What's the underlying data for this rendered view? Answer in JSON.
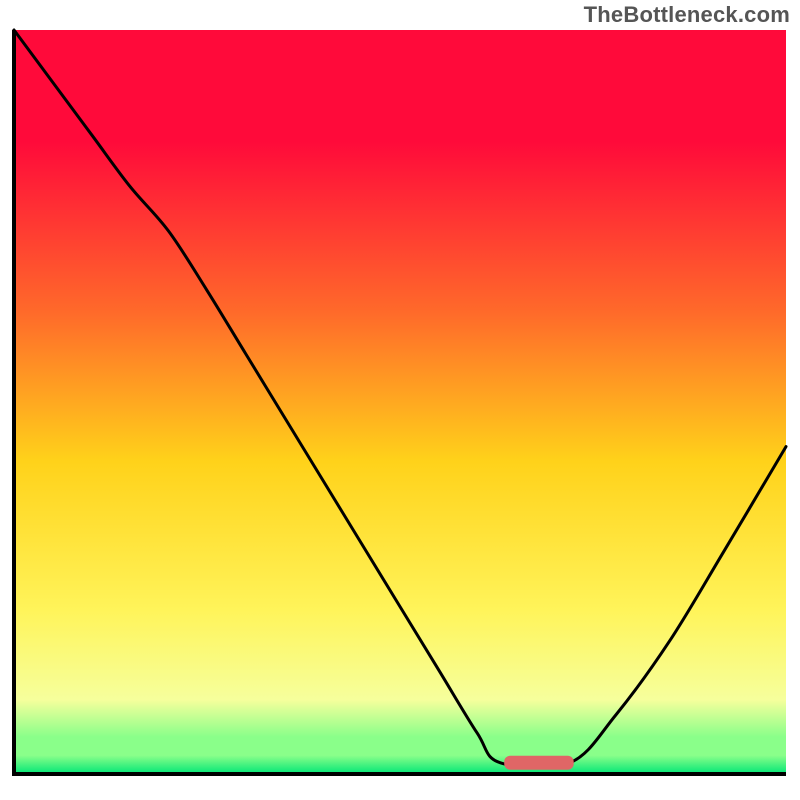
{
  "watermark": "TheBottleneck.com",
  "colors": {
    "gradient_top": "#ff0a3a",
    "gradient_mid_upper": "#ff6a2a",
    "gradient_mid": "#ffd21a",
    "gradient_mid_lower": "#fff45a",
    "gradient_lower": "#f6ff9c",
    "gradient_green_light": "#8aff8a",
    "gradient_green": "#00e676",
    "line_curve": "#000000",
    "line_axis": "#000000",
    "marker": "#e06666"
  },
  "chart_data": {
    "type": "line",
    "title": "",
    "xlabel": "",
    "ylabel": "",
    "xlim": [
      0,
      100
    ],
    "ylim": [
      0,
      100
    ],
    "marker": {
      "x_center": 68,
      "width": 9,
      "y": 1.5
    },
    "x": [
      0,
      5,
      10,
      15,
      20,
      25,
      30,
      35,
      40,
      45,
      50,
      55,
      60,
      63,
      72,
      78,
      85,
      92,
      100
    ],
    "values": [
      100,
      93,
      86,
      79,
      73,
      65,
      56.5,
      48,
      39.5,
      31,
      22.5,
      14,
      5.5,
      1.5,
      1.5,
      8,
      18,
      30,
      44
    ],
    "annotations": []
  }
}
